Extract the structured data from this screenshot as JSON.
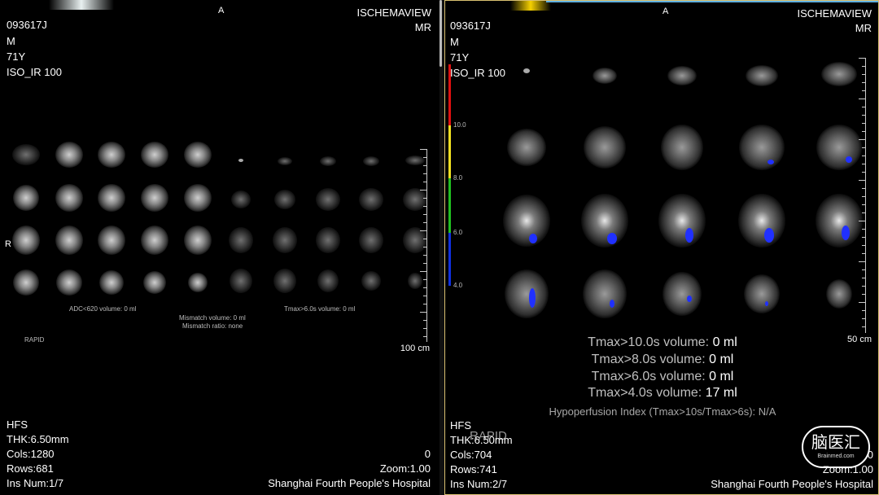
{
  "left": {
    "patient_id": "093617J",
    "orientation_top": "A",
    "vendor": "ISCHEMAVIEW",
    "modality": "MR",
    "sex": "M",
    "age": "71Y",
    "series": "ISO_IR 100",
    "orientation_side": "R",
    "adc_label": "ADC<620 volume: 0 ml",
    "mismatch_volume_label": "Mismatch volume: 0 ml",
    "mismatch_ratio_label": "Mismatch ratio: none",
    "tmax_label": "Tmax>6.0s volume: 0 ml",
    "rapid_label": "RAPID",
    "scale_label": "100 cm",
    "position": "HFS",
    "thickness": "THK:6.50mm",
    "cols": "Cols:1280",
    "rows": "Rows:681",
    "ins_num": "Ins Num:1/7",
    "value": "0",
    "zoom": "Zoom:1.00",
    "hospital": "Shanghai Fourth People's Hospital"
  },
  "right": {
    "patient_id": "093617J",
    "orientation_top": "A",
    "vendor": "ISCHEMAVIEW",
    "modality": "MR",
    "sex": "M",
    "age": "71Y",
    "series": "ISO_IR 100",
    "colorbar_labels": [
      "10.0",
      "8.0",
      "6.0",
      "4.0"
    ],
    "scale_label": "50 cm",
    "stats": {
      "tmax10_text": "Tmax>10.0s volume: ",
      "tmax10_value": "0 ml",
      "tmax8_text": "Tmax>8.0s volume: ",
      "tmax8_value": "0 ml",
      "tmax6_text": "Tmax>6.0s volume: ",
      "tmax6_value": "0 ml",
      "tmax4_text": "Tmax>4.0s volume: ",
      "tmax4_value": "17 ml",
      "hypoperfusion": "Hypoperfusion Index (Tmax>10s/Tmax>6s): N/A"
    },
    "position": "HFS",
    "rapid_label": "RAPID",
    "thickness": "THK:6.50mm",
    "cols": "Cols:704",
    "rows": "Rows:741",
    "ins_num": "Ins Num:2/7",
    "value": "0",
    "zoom": "Zoom:1.00",
    "hospital": "Shanghai Fourth People's Hospital"
  },
  "watermark": {
    "text": "脑医汇",
    "subtext": "Brainmed.com"
  },
  "colors": {
    "background": "#000000",
    "viewport_border": "#d8c070",
    "colorbar_red": "#e01010",
    "colorbar_yellow": "#f0e020",
    "colorbar_green": "#20c020",
    "colorbar_blue": "#1030e0",
    "perfusion_overlay": "#2030ff"
  }
}
